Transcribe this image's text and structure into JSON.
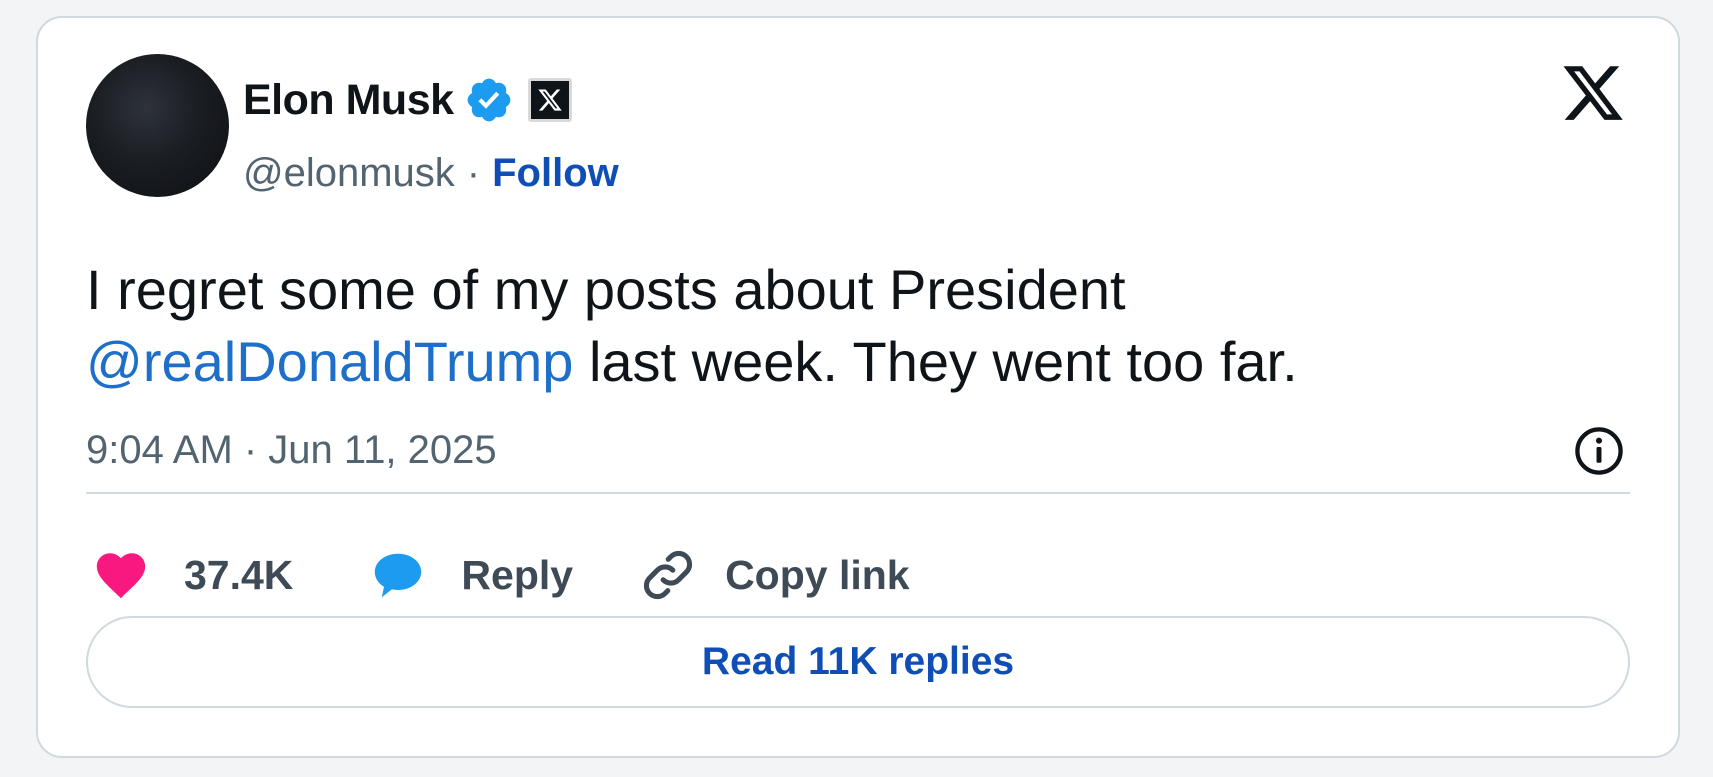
{
  "author": {
    "name": "Elon Musk",
    "handle": "@elonmusk",
    "separator": "·",
    "follow_label": "Follow"
  },
  "tweet": {
    "text_line1": "I regret some of my posts about President",
    "mention": "@realDonaldTrump",
    "text_line2_rest": " last week. They went too far.",
    "timestamp": "9:04 AM · Jun 11, 2025"
  },
  "actions": {
    "likes_count": "37.4K",
    "reply_label": "Reply",
    "copy_link_label": "Copy link"
  },
  "read_replies_label": "Read 11K replies",
  "icons": {
    "verified": "verified-badge-icon",
    "affiliate": "x-affiliate-badge-icon",
    "brand": "x-logo-icon",
    "info": "info-icon",
    "like": "heart-icon",
    "reply": "speech-bubble-icon",
    "copy": "link-icon"
  },
  "colors": {
    "verified_blue": "#1d9bf0",
    "like_pink": "#f91880",
    "link_blue": "#0f4fb5",
    "mention_blue": "#1d6fc9",
    "text_primary": "#0f1419",
    "text_secondary": "#536471"
  }
}
